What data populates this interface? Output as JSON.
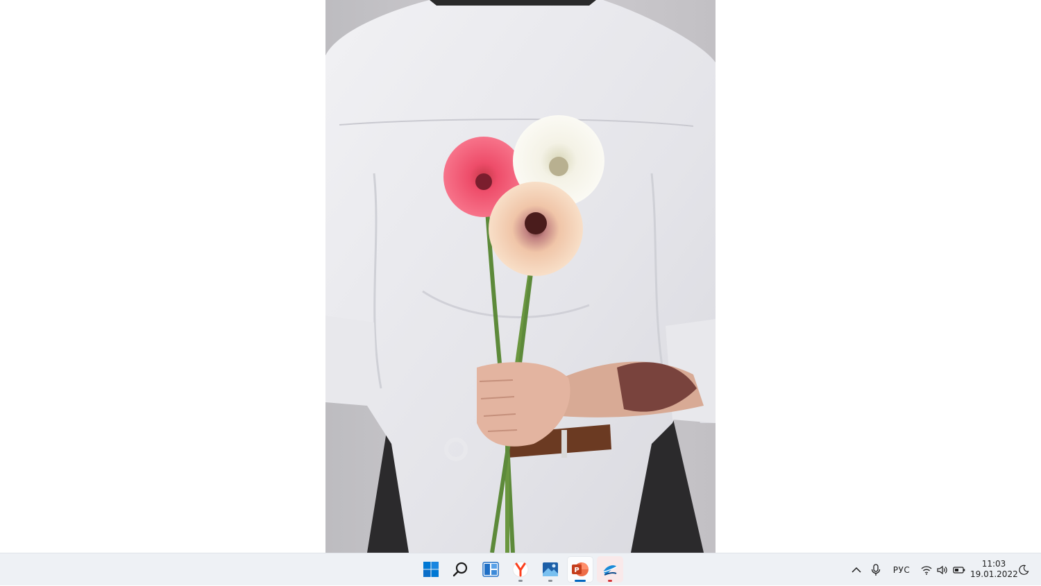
{
  "desktop": {
    "background_color": "#ffffff",
    "photo": {
      "subject": "person in white shirt holding gerbera flowers behind back"
    }
  },
  "taskbar": {
    "apps": [
      {
        "name": "start",
        "icon": "windows-start-icon",
        "running": false
      },
      {
        "name": "search",
        "icon": "search-icon",
        "running": false
      },
      {
        "name": "widgets",
        "icon": "widgets-icon",
        "running": false
      },
      {
        "name": "yandex-browser",
        "icon": "yandex-browser-icon",
        "running": true
      },
      {
        "name": "photos",
        "icon": "photos-icon",
        "running": true
      },
      {
        "name": "powerpoint",
        "icon": "powerpoint-icon",
        "running": true,
        "active": true
      },
      {
        "name": "app",
        "icon": "app-icon",
        "running": true
      }
    ],
    "tray": {
      "overflow_icon": "chevron-up-icon",
      "mic_icon": "microphone-icon",
      "language": "РУС",
      "wifi_icon": "wifi-icon",
      "volume_icon": "volume-icon",
      "battery_icon": "battery-icon",
      "time": "11:03",
      "date": "19.01.2022",
      "focus_icon": "moon-icon"
    },
    "colors": {
      "background": "#eef1f5",
      "accent": "#0067c0",
      "powerpoint": "#c43e1c",
      "yandex": "#fc3f1d"
    }
  }
}
